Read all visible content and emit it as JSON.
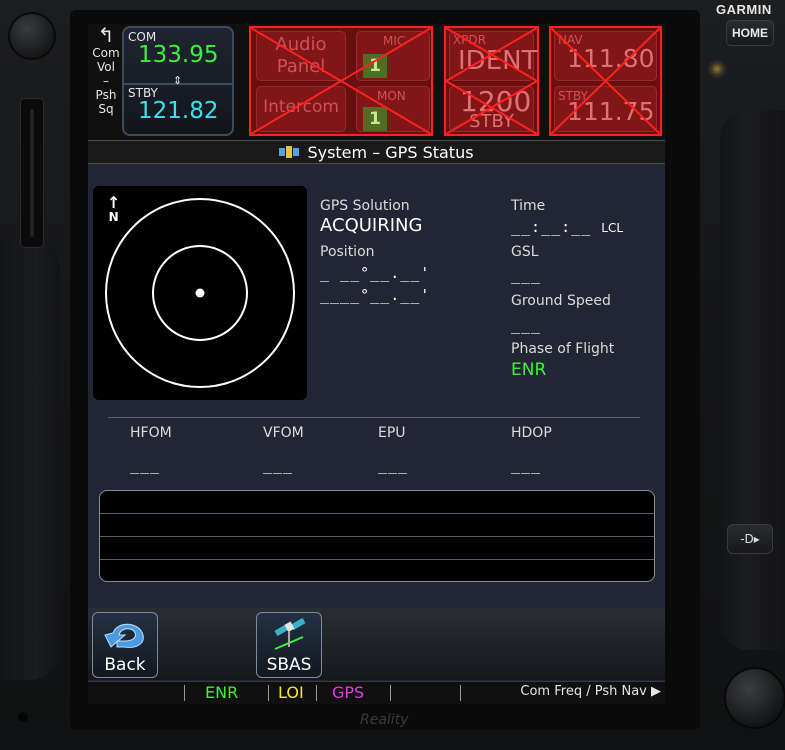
{
  "bezel": {
    "brand": "GARMIN",
    "home_label": "HOME",
    "direct_to_label": "-D▸",
    "watermark": "Reality"
  },
  "com": {
    "vol_arrow": "↰",
    "vol_lines": [
      "Com",
      "Vol",
      "–",
      "Psh",
      "Sq"
    ],
    "label": "COM",
    "active": "133.95",
    "swap": "⇕",
    "stby_label": "STBY",
    "standby": "121.82"
  },
  "audio": {
    "audio_panel_line1": "Audio",
    "audio_panel_line2": "Panel",
    "intercom": "Intercom",
    "mic_label": "MIC",
    "mic_value": "1",
    "mon_label": "MON",
    "mon_value": "1"
  },
  "xpdr": {
    "label": "XPDR",
    "ident": "IDENT",
    "code": "1200",
    "mode": "STBY"
  },
  "nav": {
    "label": "NAV",
    "active": "111.80",
    "stby_label": "STBY",
    "standby": "111.75"
  },
  "page": {
    "title": "System – GPS Status"
  },
  "skyview": {
    "north_arrow": "↑",
    "north_label": "N"
  },
  "gps": {
    "solution_label": "GPS Solution",
    "solution": "ACQUIRING",
    "position_label": "Position",
    "lat": "_ __°__.__'",
    "lon": "____°__.__'",
    "time_label": "Time",
    "time": "__:__:__",
    "time_suffix": "LCL",
    "gsl_label": "GSL",
    "gsl": "___",
    "gs_label": "Ground Speed",
    "gs": "___",
    "phase_label": "Phase of Flight",
    "phase": "ENR"
  },
  "accuracy": {
    "hfom_label": "HFOM",
    "hfom": "___",
    "vfom_label": "VFOM",
    "vfom": "___",
    "epu_label": "EPU",
    "epu": "___",
    "hdop_label": "HDOP",
    "hdop": "___"
  },
  "satellites": {
    "prns": [
      "__",
      "__",
      "__",
      "__",
      "__",
      "__",
      "__",
      "__",
      "__",
      "__",
      "__",
      "__",
      "__",
      "__",
      "__"
    ]
  },
  "softkeys": {
    "back": "Back",
    "sbas": "SBAS"
  },
  "status": {
    "enr": "ENR",
    "loi": "LOI",
    "gps": "GPS",
    "com_freq": "Com Freq / Psh Nav ▶"
  },
  "colors": {
    "active_freq": "#3ef03e",
    "standby_freq": "#3fe0ee",
    "loi": "#f5ec2a",
    "gps": "#e23de6",
    "fail_border": "#ff2020"
  }
}
